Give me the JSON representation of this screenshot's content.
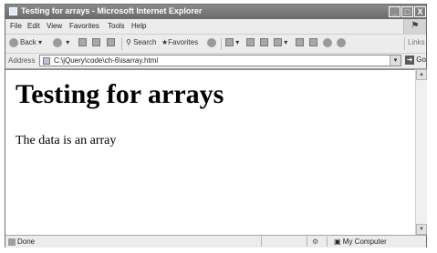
{
  "window": {
    "title": "Testing for arrays - Microsoft Internet Explorer",
    "controls": {
      "minimize": "_",
      "maximize": "□",
      "close": "X"
    }
  },
  "menu": {
    "items": [
      "File",
      "Edit",
      "View",
      "Favorites",
      "Tools",
      "Help"
    ]
  },
  "toolbar": {
    "back": "Back",
    "search": "Search",
    "favorites": "Favorites",
    "links": "Links"
  },
  "address": {
    "label": "Address",
    "url": "C:\\jQuery\\code\\ch-6\\isarray.html",
    "go": "Go"
  },
  "page": {
    "heading": "Testing for arrays",
    "message": "The data is an array"
  },
  "status": {
    "text": "Done",
    "zone": "My Computer"
  }
}
